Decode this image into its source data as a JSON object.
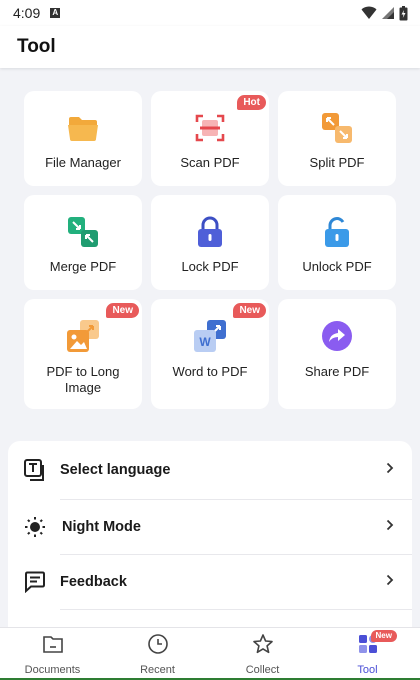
{
  "status": {
    "time": "4:09",
    "notif_letter": "A"
  },
  "header": {
    "title": "Tool"
  },
  "tools": [
    {
      "label": "File Manager",
      "icon": "folder-icon",
      "badge": ""
    },
    {
      "label": "Scan PDF",
      "icon": "scan-icon",
      "badge": "Hot"
    },
    {
      "label": "Split PDF",
      "icon": "split-icon",
      "badge": ""
    },
    {
      "label": "Merge PDF",
      "icon": "merge-icon",
      "badge": ""
    },
    {
      "label": "Lock PDF",
      "icon": "lock-icon",
      "badge": ""
    },
    {
      "label": "Unlock PDF",
      "icon": "unlock-icon",
      "badge": ""
    },
    {
      "label": "PDF to Long Image",
      "icon": "long-image-icon",
      "badge": "New"
    },
    {
      "label": "Word to PDF",
      "icon": "word-icon",
      "badge": "New"
    },
    {
      "label": "Share PDF",
      "icon": "share-icon",
      "badge": ""
    }
  ],
  "settings": [
    {
      "label": "Select language",
      "icon": "language-icon"
    },
    {
      "label": "Night Mode",
      "icon": "brightness-icon"
    },
    {
      "label": "Feedback",
      "icon": "feedback-icon"
    }
  ],
  "nav": {
    "documents": "Documents",
    "recent": "Recent",
    "collect": "Collect",
    "tool": "Tool",
    "tool_badge": "New"
  },
  "colors": {
    "accent": "#4b4fd6",
    "hot_badge": "#e85a5a",
    "orange": "#f29a38",
    "red": "#e5484d",
    "green": "#22b07d",
    "indigo": "#4f5fd8",
    "blue": "#3b9ae8",
    "purple": "#8a5cf0"
  }
}
